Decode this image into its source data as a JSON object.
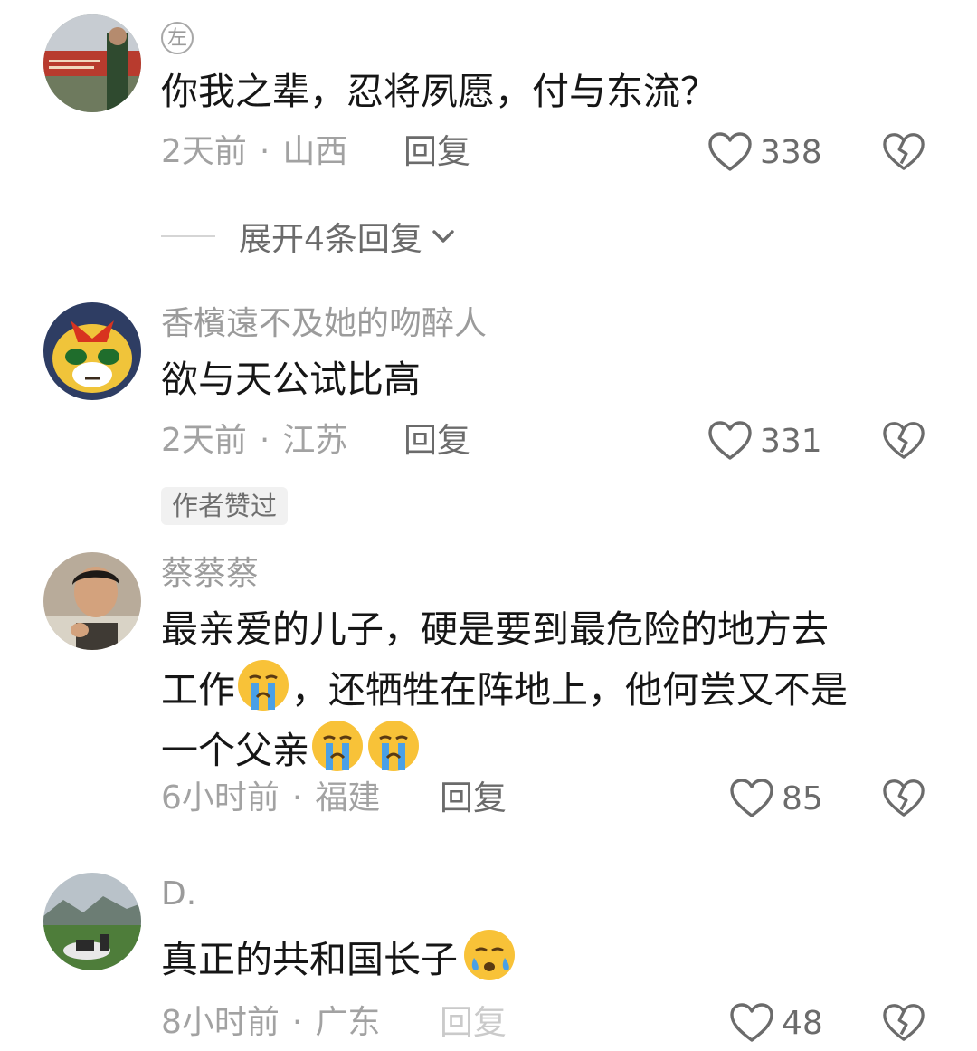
{
  "comments": [
    {
      "username": "",
      "username_badge": "左",
      "text_lines": [
        "你我之辈，忍将夙愿，付与东流？"
      ],
      "time": "2天前",
      "location": "山西",
      "reply_label": "回复",
      "likes": "338"
    },
    {
      "username": "香檳遠不及她的吻醉人",
      "text_lines": [
        "欲与天公试比高"
      ],
      "time": "2天前",
      "location": "江苏",
      "reply_label": "回复",
      "likes": "331",
      "author_liked_tag": "作者赞过"
    },
    {
      "username": "蔡蔡蔡",
      "text_line1": "最亲爱的儿子，硬是要到最危险的地方去",
      "text_line2a": "工作",
      "text_line2b": "，还牺牲在阵地上，他何尝又不是",
      "text_line3": "一个父亲",
      "time": "6小时前",
      "location": "福建",
      "reply_label": "回复",
      "likes": "85"
    },
    {
      "username": "D.",
      "text": "真正的共和国长子",
      "time": "8小时前",
      "location": "广东",
      "reply_label": "回复",
      "likes": "48"
    }
  ],
  "expand_replies": "展开4条回复",
  "meta_separator": "·",
  "icons": {
    "like": "heart-outline-icon",
    "dislike": "broken-heart-icon",
    "expand": "chevron-down-icon",
    "emoji_cry": "loudly-crying-face-emoji",
    "emoji_sad": "sad-tear-face-emoji"
  },
  "colors": {
    "username": "#9b9b9b",
    "text": "#161616",
    "meta": "#a2a2a2",
    "action": "#6b6b6b"
  }
}
